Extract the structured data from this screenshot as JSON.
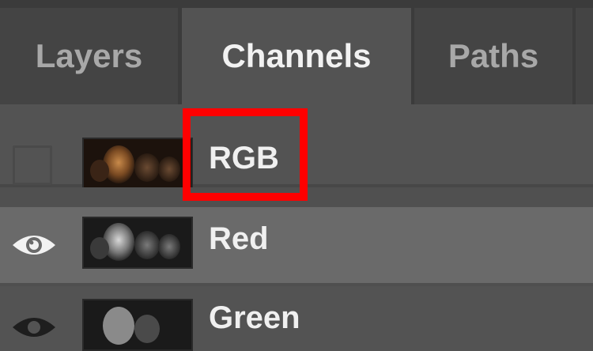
{
  "tabs": [
    {
      "label": "Layers",
      "active": false
    },
    {
      "label": "Channels",
      "active": true
    },
    {
      "label": "Paths",
      "active": false
    }
  ],
  "channels": [
    {
      "label": "RGB",
      "visible": false,
      "highlighted": true
    },
    {
      "label": "Red",
      "visible": true,
      "highlighted": false
    },
    {
      "label": "Green",
      "visible": true,
      "highlighted": false
    }
  ],
  "colors": {
    "highlight_box": "#ff0000",
    "panel_bg": "#535353",
    "selected_row_bg": "#6a6a6a",
    "tab_bar_bg": "#3b3b3b"
  },
  "icons": {
    "visibility": "eye-icon"
  }
}
